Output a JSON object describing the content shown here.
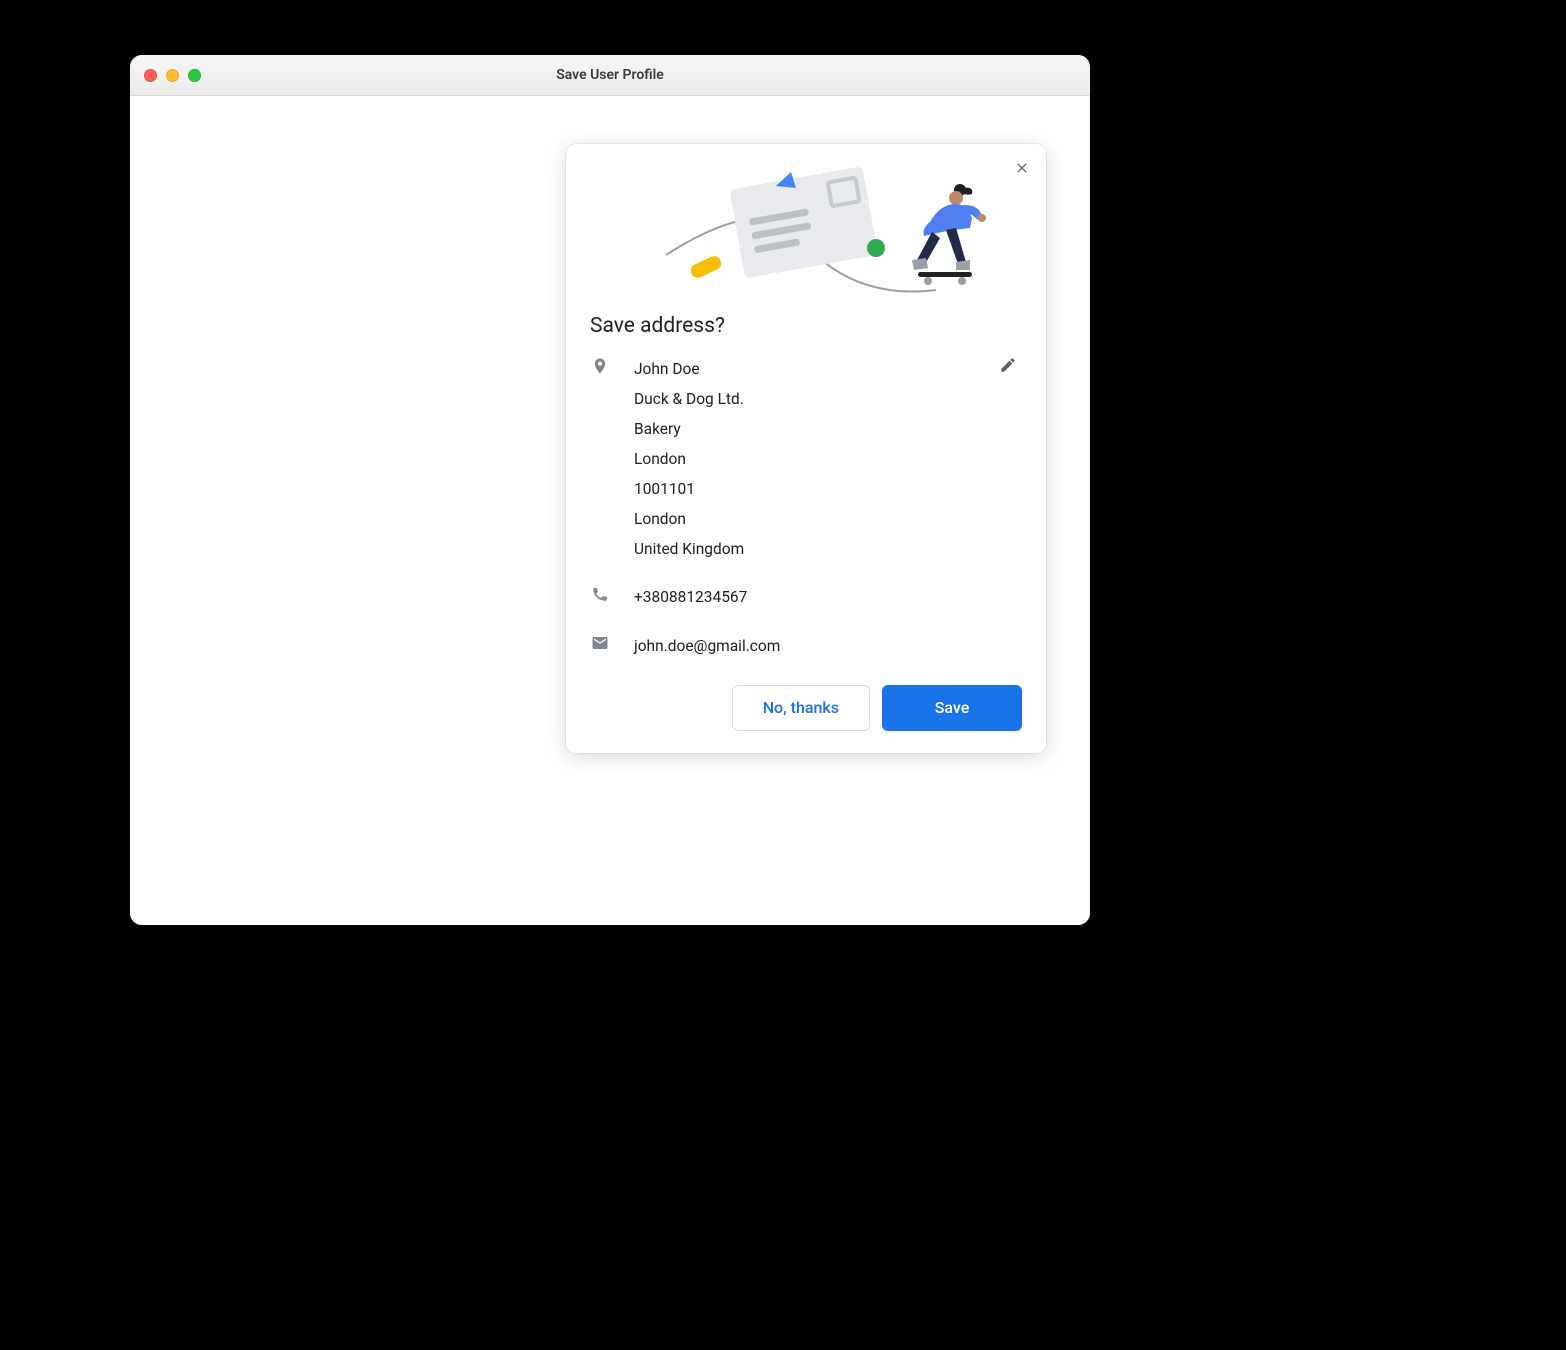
{
  "window": {
    "title": "Save User Profile"
  },
  "popup": {
    "title": "Save address?",
    "address": {
      "name": "John Doe",
      "company": "Duck & Dog Ltd.",
      "dept": "Bakery",
      "city1": "London",
      "postcode": "1001101",
      "city2": "London",
      "country": "United Kingdom"
    },
    "phone": "+380881234567",
    "email": "john.doe@gmail.com",
    "buttons": {
      "decline": "No, thanks",
      "accept": "Save"
    }
  }
}
